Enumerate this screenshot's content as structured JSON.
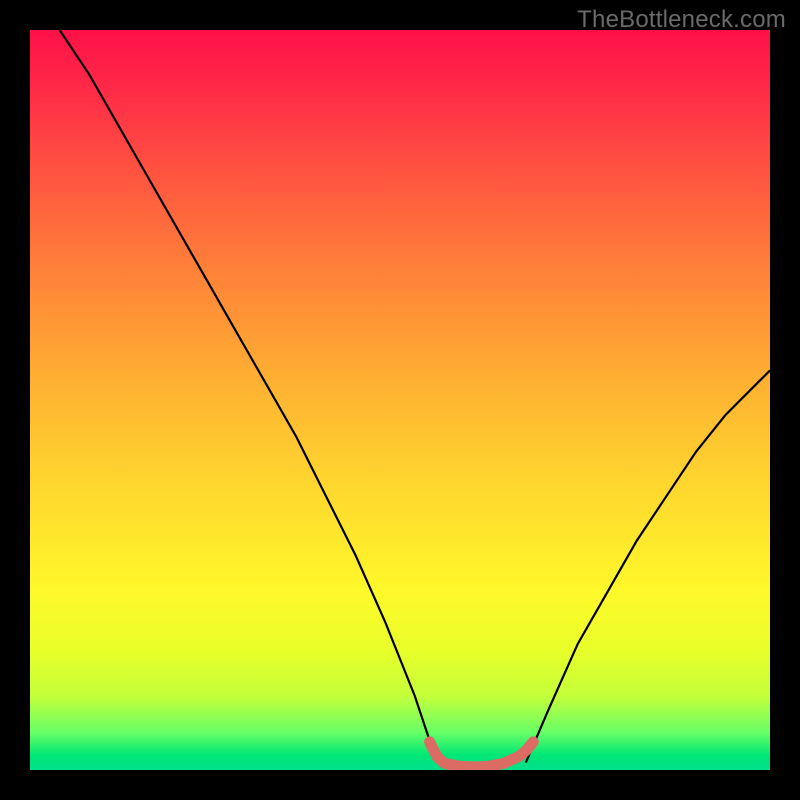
{
  "header": {
    "watermark": "TheBottleneck.com"
  },
  "chart_data": {
    "type": "line",
    "title": "",
    "xlabel": "",
    "ylabel": "",
    "x_range": [
      0,
      100
    ],
    "y_range": [
      0,
      100
    ],
    "grid": false,
    "legend": {
      "visible": false
    },
    "background_gradient": {
      "direction": "vertical_top_to_bottom",
      "stops": [
        {
          "color": "#ff1048",
          "pos": 0
        },
        {
          "color": "#ffd82e",
          "pos": 56
        },
        {
          "color": "#fff92a",
          "pos": 76
        },
        {
          "color": "#00e676",
          "pos": 98
        }
      ]
    },
    "series": [
      {
        "name": "left-curve",
        "color": "#000000",
        "x": [
          4,
          8,
          12,
          16,
          20,
          24,
          28,
          32,
          36,
          40,
          44,
          48,
          52,
          55
        ],
        "values": [
          100,
          94,
          87,
          80,
          73,
          66,
          59,
          52,
          45,
          37,
          29,
          20,
          10,
          1
        ]
      },
      {
        "name": "valley-red",
        "color": "#db6b63",
        "x": [
          54,
          55,
          56,
          58,
          60,
          62,
          64,
          66,
          67,
          68
        ],
        "values": [
          3.8,
          1.8,
          0.9,
          0.5,
          0.4,
          0.5,
          0.9,
          1.8,
          2.6,
          3.8
        ]
      },
      {
        "name": "right-curve",
        "color": "#000000",
        "x": [
          67,
          70,
          74,
          78,
          82,
          86,
          90,
          94,
          98,
          100
        ],
        "values": [
          1,
          8,
          17,
          24,
          31,
          37,
          43,
          48,
          52,
          54
        ]
      }
    ]
  }
}
